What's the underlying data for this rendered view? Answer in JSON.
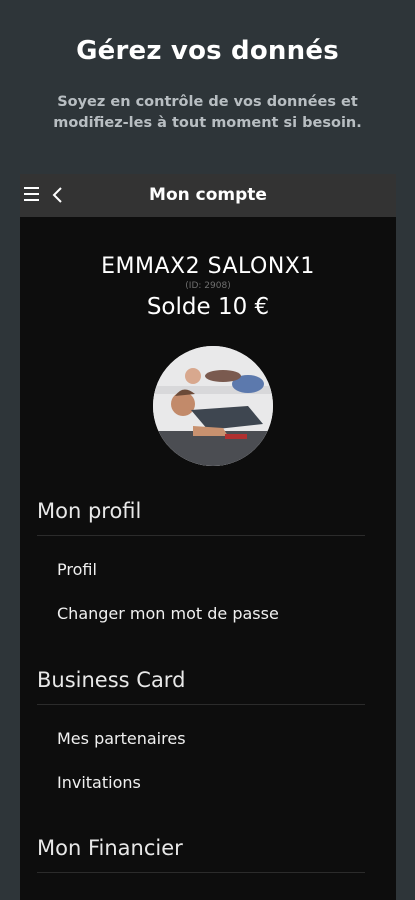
{
  "promo": {
    "title": "Gérez vos donnés",
    "subtitle": "Soyez en contrôle de vos données et modifiez-les à tout moment si besoin."
  },
  "appbar": {
    "title": "Mon compte",
    "menu_icon": "hamburger-menu-icon",
    "back_icon": "chevron-left-icon"
  },
  "user": {
    "name": "EMMAX2 SALONX1",
    "id_label": "(ID: 2908)",
    "balance": "Solde 10 €"
  },
  "sections": [
    {
      "title": "Mon profil",
      "items": [
        "Profil",
        "Changer mon mot de passe"
      ]
    },
    {
      "title": "Business Card",
      "items": [
        "Mes partenaires",
        "Invitations"
      ]
    },
    {
      "title": "Mon Financier",
      "items": []
    }
  ],
  "colors": {
    "background": "#2e3539",
    "appbar": "#333333",
    "content": "#0d0d0d",
    "subtitle": "#b8bec2"
  }
}
